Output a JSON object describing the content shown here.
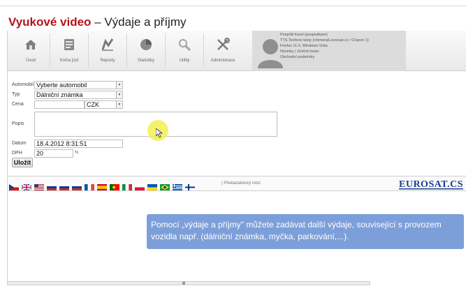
{
  "heading": {
    "accent": "Vyukové video",
    "rest": " – Výdaje a příjmy"
  },
  "toolbar": {
    "buttons": [
      {
        "label": "Úvod",
        "icon": "home-icon"
      },
      {
        "label": "Kniha jízd",
        "icon": "logbook-icon"
      },
      {
        "label": "Reporty",
        "icon": "reports-icon"
      },
      {
        "label": "Statistiky",
        "icon": "statistics-icon"
      },
      {
        "label": "Utility",
        "icon": "utility-icon"
      },
      {
        "label": "Administrace",
        "icon": "administration-icon"
      }
    ]
  },
  "user": {
    "line1": "Pospíšil Karel (pospisilkare)",
    "line2": "TTS Technici testy (chimera6.eurosat.cz / Charon 1)",
    "line3": "Firefox 11.0, Windows Vista",
    "links": {
      "news": "Novinky",
      "separator": "|",
      "change_password": "Změnit heslo"
    },
    "terms": "Obchodní podmínky"
  },
  "form": {
    "vehicle": {
      "label": "Automobil",
      "value": "Vyberte automobil"
    },
    "type": {
      "label": "Typ",
      "value": "Dálniční známka"
    },
    "price": {
      "label": "Cena",
      "value": "",
      "currency": "CZK"
    },
    "description": {
      "label": "Popis",
      "value": ""
    },
    "date": {
      "label": "Datum",
      "value": "18.4.2012 8:31:51"
    },
    "vat": {
      "label": "DPH",
      "value": "20",
      "unit": "%"
    },
    "save_label": "Uložit"
  },
  "flags": {
    "items": [
      "cz",
      "gb",
      "us",
      "ru",
      "ru",
      "ru",
      "fr",
      "es",
      "pt",
      "it",
      "pl",
      "ua",
      "br",
      "gr",
      "fi"
    ],
    "translation_mode": "| Překladatelský mód"
  },
  "logo_text": "EUROSAT.CS",
  "callout_text": "Pomocí „výdaje a příjmy\" můžete zadávat další výdaje, související s provozem vozidla např. (dálniční známka, myčka, parkování,...).",
  "colors": {
    "accent": "#b5121b",
    "callout": "#7d9fd9",
    "logo": "#1a3f8f",
    "highlight": "#f4ee54"
  }
}
